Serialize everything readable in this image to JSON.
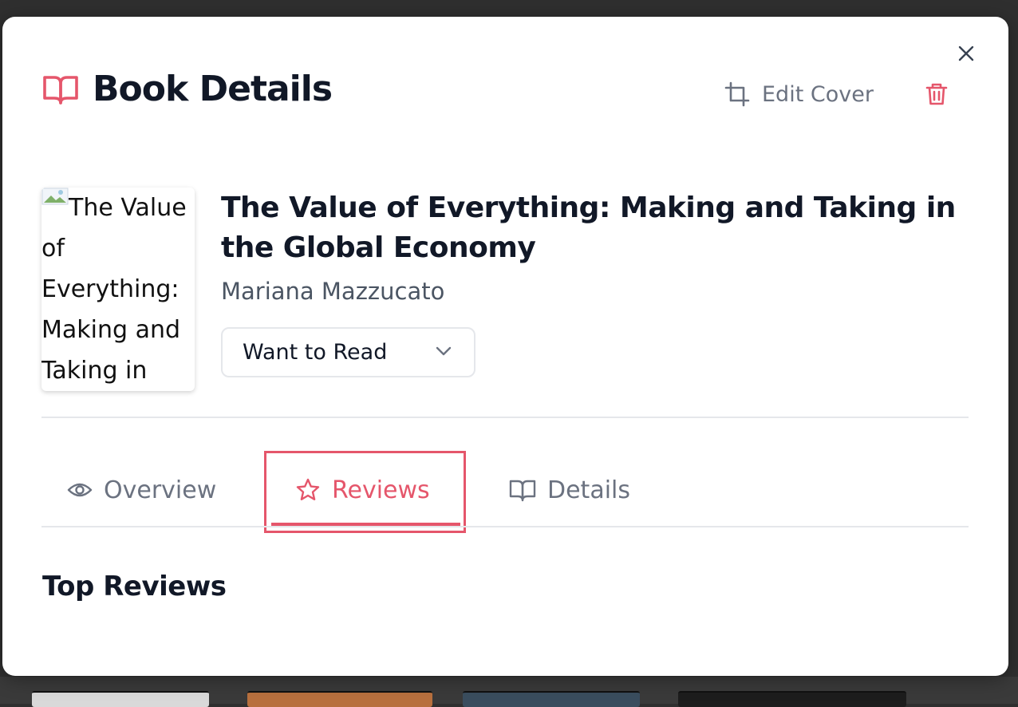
{
  "modal": {
    "title": "Book Details",
    "edit_cover_label": "Edit Cover",
    "icons": {
      "title": "book-open-icon",
      "edit_cover": "crop-icon",
      "delete": "trash-icon",
      "close": "close-icon"
    }
  },
  "book": {
    "cover_alt_lines": [
      "The Value",
      "of",
      "Everything:",
      "Making and",
      "Taking in"
    ],
    "title": "The Value of Everything: Making and Taking in the Global Economy",
    "author": "Mariana Mazzucato",
    "status": "Want to Read"
  },
  "tabs": [
    {
      "label": "Overview",
      "icon": "eye-icon",
      "active": false
    },
    {
      "label": "Reviews",
      "icon": "star-icon",
      "active": true
    },
    {
      "label": "Details",
      "icon": "book-open-icon",
      "active": false
    }
  ],
  "reviews": {
    "section_title": "Top Reviews"
  },
  "colors": {
    "accent": "#e5566b",
    "text_primary": "#111827",
    "text_secondary": "#6b7280",
    "border": "#e5e7eb",
    "backdrop": "#2f2f2f"
  }
}
